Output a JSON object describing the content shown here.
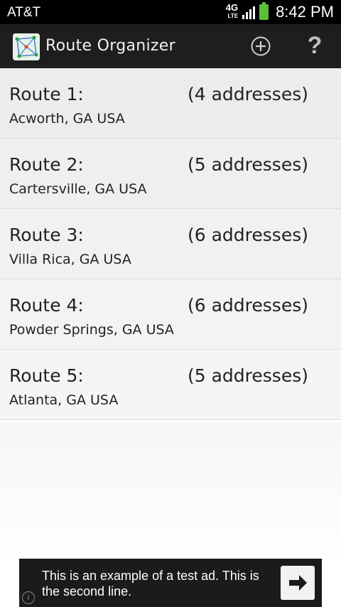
{
  "status_bar": {
    "carrier": "AT&T",
    "network": "4G",
    "network_sub": "LTE",
    "time": "8:42 PM"
  },
  "app_bar": {
    "title": "Route Organizer",
    "add_icon": "plus-circle-icon",
    "help_label": "?"
  },
  "routes": [
    {
      "name": "Route 1:",
      "count": "(4 addresses)",
      "location": "Acworth, GA USA"
    },
    {
      "name": "Route 2:",
      "count": "(5 addresses)",
      "location": "Cartersville, GA USA"
    },
    {
      "name": "Route 3:",
      "count": "(6 addresses)",
      "location": "Villa Rica, GA USA"
    },
    {
      "name": "Route 4:",
      "count": "(6 addresses)",
      "location": "Powder Springs, GA USA"
    },
    {
      "name": "Route 5:",
      "count": "(5 addresses)",
      "location": "Atlanta, GA USA"
    }
  ],
  "ad": {
    "line1": "This is an example of a test ad. This is",
    "line2": "the second line.",
    "info_icon": "info-icon",
    "arrow_icon": "arrow-right-icon"
  },
  "colors": {
    "action_bar": "#1e1e1e",
    "battery": "#5cc036"
  }
}
